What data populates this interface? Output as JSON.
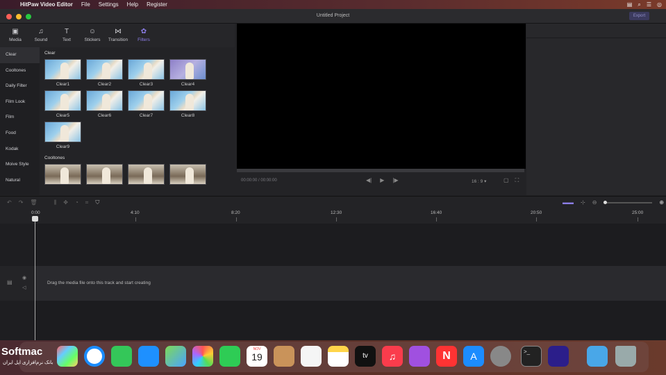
{
  "menubar": {
    "app": "HitPaw Video Editor",
    "items": [
      "File",
      "Settings",
      "Help",
      "Register"
    ]
  },
  "window": {
    "title": "Untitled Project",
    "export_label": "Export"
  },
  "tabs": [
    {
      "label": "Media",
      "icon": "media-icon"
    },
    {
      "label": "Sound",
      "icon": "music-note-icon"
    },
    {
      "label": "Text",
      "icon": "text-icon"
    },
    {
      "label": "Stickers",
      "icon": "smiley-icon"
    },
    {
      "label": "Transition",
      "icon": "transition-icon"
    },
    {
      "label": "Filters",
      "icon": "filters-icon",
      "active": true
    }
  ],
  "categories": [
    "Clear",
    "Cooltones",
    "Daily Filter",
    "Film Look",
    "Film",
    "Food",
    "Kodak",
    "Moive Style",
    "Natural"
  ],
  "filters": {
    "section1": "Clear",
    "items": [
      "Clear1",
      "Clear2",
      "Clear3",
      "Clear4",
      "Clear5",
      "Clear6",
      "Clear7",
      "Clear8",
      "Clear9"
    ],
    "section2": "Cooltones"
  },
  "player": {
    "time": "00:00:00 / 00:00:00",
    "ratio": "16 : 9"
  },
  "timeline": {
    "ticks": [
      "0:00",
      "4:10",
      "8:20",
      "12:30",
      "16:40",
      "20:50",
      "25:00"
    ],
    "hint": "Drag the media file onto this track and start creating"
  },
  "dock": {
    "calendar_month": "NOV",
    "calendar_day": "19",
    "appletv": "tv"
  },
  "watermark": {
    "brand": "Softmac",
    "tagline": "بانک نرم‌افزاری اپل ایران"
  },
  "colors": {
    "accent": "#8c7ee8",
    "export_bg": "#3b3a5e"
  }
}
